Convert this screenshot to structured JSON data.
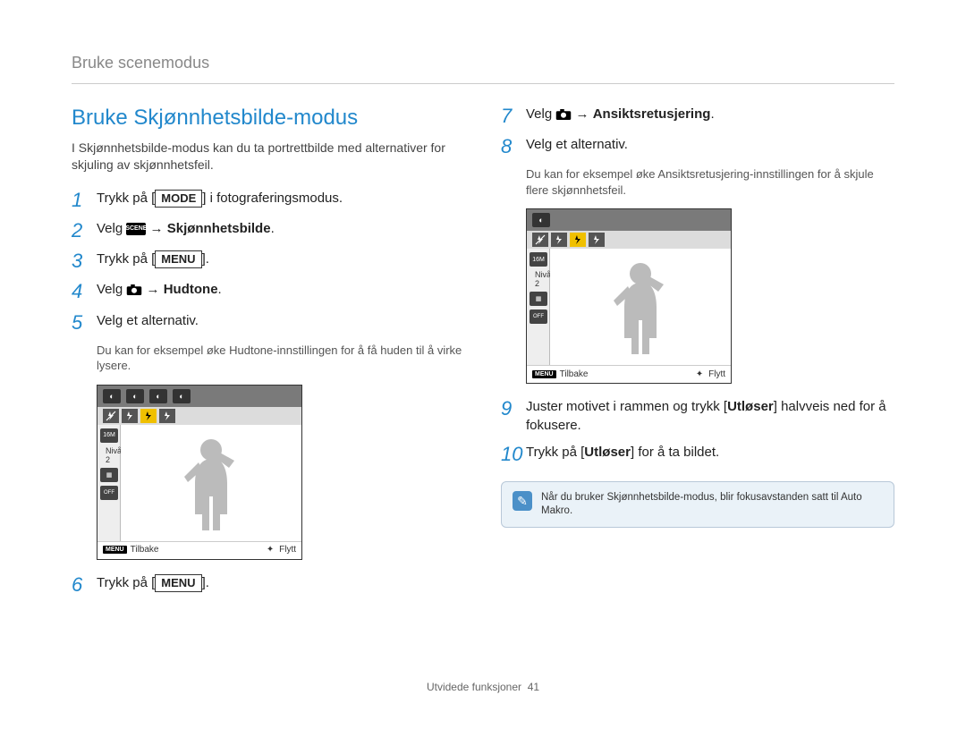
{
  "breadcrumb": "Bruke scenemodus",
  "section_title": "Bruke Skjønnhetsbilde-modus",
  "intro": "I Skjønnhetsbilde-modus kan du ta portrettbilde med alternativer for skjuling av skjønnhetsfeil.",
  "steps_left": [
    {
      "num": "1",
      "pre": "Trykk på [",
      "btn": "MODE",
      "post": "] i fotograferingsmodus."
    },
    {
      "num": "2",
      "pre": "Velg ",
      "icon": "scene",
      "btn_text": "SCENE",
      "post": " → ",
      "bold": "Skjønnhetsbilde",
      "tail": "."
    },
    {
      "num": "3",
      "pre": "Trykk på [",
      "btn": "MENU",
      "post": "]."
    },
    {
      "num": "4",
      "pre": "Velg ",
      "icon": "camera",
      "post": " → ",
      "bold": "Hudtone",
      "tail": "."
    },
    {
      "num": "5",
      "pre": "Velg et alternativ.",
      "sub": "Du kan for eksempel øke Hudtone-innstillingen for å få huden til å virke lysere."
    },
    {
      "num": "6",
      "pre": "Trykk på [",
      "btn": "MENU",
      "post": "]."
    }
  ],
  "steps_right": [
    {
      "num": "7",
      "pre": "Velg ",
      "icon": "camera",
      "post": " → ",
      "bold": "Ansiktsretusjering",
      "tail": "."
    },
    {
      "num": "8",
      "pre": "Velg et alternativ.",
      "sub": "Du kan for eksempel øke Ansiktsretusjering-innstillingen for å skjule flere skjønnhetsfeil."
    },
    {
      "num": "9",
      "pre": "Juster motivet i rammen og trykk [",
      "bold": "Utløser",
      "post": "] halvveis ned for å fokusere."
    },
    {
      "num": "10",
      "pre": "Trykk på [",
      "bold": "Utløser",
      "post": "] for å ta bildet."
    }
  ],
  "lcd": {
    "level_label": "Nivå 2",
    "size_badge": "16M",
    "back_label": "Tilbake",
    "back_btn": "MENU",
    "move_label": "Flytt",
    "off_label": "OFF"
  },
  "note": "Når du bruker Skjønnhetsbilde-modus, blir fokusavstanden satt til Auto Makro.",
  "footer": {
    "label": "Utvidede funksjoner",
    "page": "41"
  }
}
